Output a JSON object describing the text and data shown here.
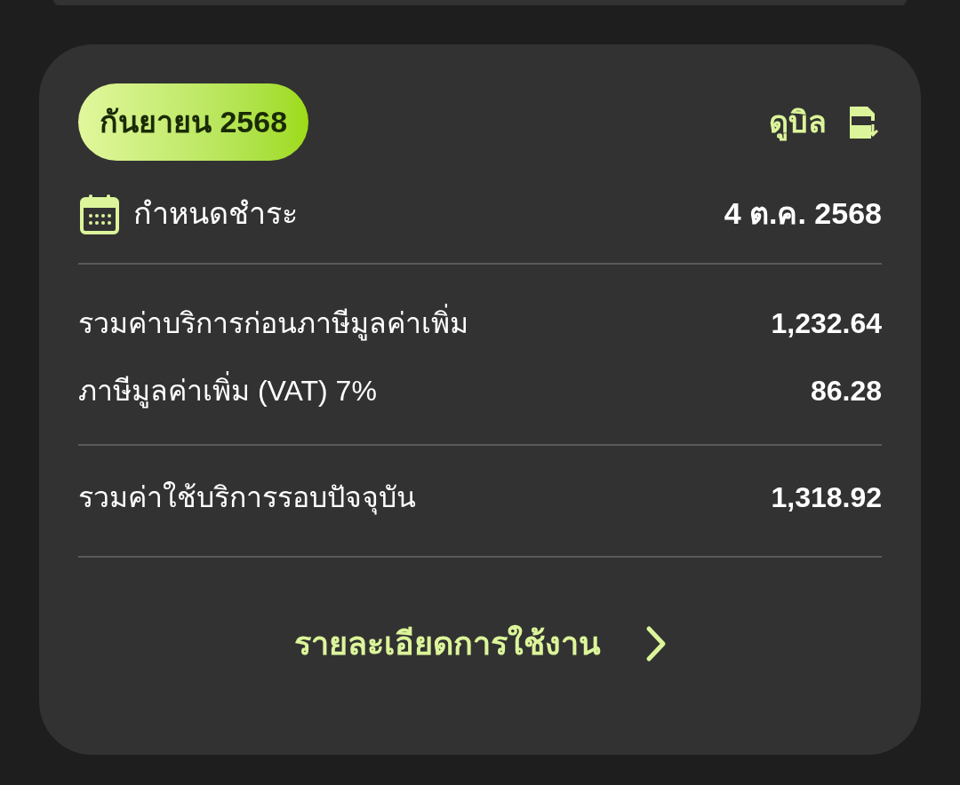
{
  "bill": {
    "period": "กันยายน 2568",
    "view_bill": "ดูบิล",
    "due_label": "กำหนดชำระ",
    "due_date": "4 ต.ค. 2568",
    "lines": [
      {
        "label": "รวมค่าบริการก่อนภาษีมูลค่าเพิ่ม",
        "amount": "1,232.64"
      },
      {
        "label": "ภาษีมูลค่าเพิ่ม (VAT) 7%",
        "amount": "86.28"
      }
    ],
    "total": {
      "label": "รวมค่าใช้บริการรอบปัจจุบัน",
      "amount": "1,318.92"
    },
    "details_link": "รายละเอียดการใช้งาน"
  }
}
